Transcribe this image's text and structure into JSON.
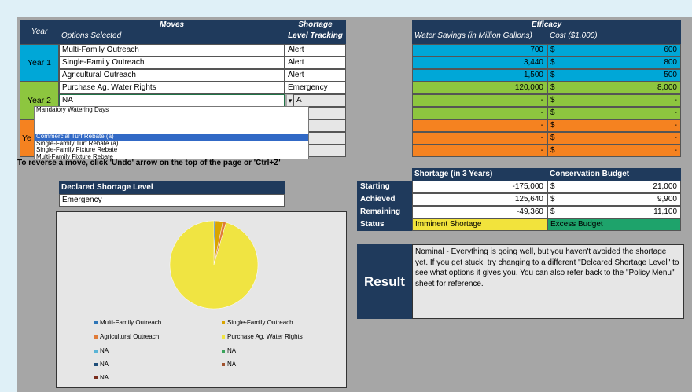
{
  "headers": {
    "year": "Year",
    "moves": "Moves",
    "options_selected": "Options Selected",
    "shortage": "Shortage",
    "level_tracking": "Level Tracking",
    "efficacy": "Efficacy",
    "water_savings": "Water Savings (in Million Gallons)",
    "cost": "Cost ($1,000)"
  },
  "years": {
    "year1": "Year 1",
    "year2": "Year 2",
    "year3_partial": "Ye"
  },
  "moves": [
    {
      "option": "Multi-Family Outreach",
      "level": "Alert",
      "savings": "700",
      "currency": "$",
      "cost": "600"
    },
    {
      "option": "Single-Family Outreach",
      "level": "Alert",
      "savings": "3,440",
      "currency": "$",
      "cost": "800"
    },
    {
      "option": "Agricultural Outreach",
      "level": "Alert",
      "savings": "1,500",
      "currency": "$",
      "cost": "500"
    },
    {
      "option": "Purchase Ag. Water Rights",
      "level": "Emergency",
      "savings": "120,000",
      "currency": "$",
      "cost": "8,000"
    },
    {
      "option": "NA",
      "level": "A",
      "savings": "-",
      "currency": "$",
      "cost": "-"
    },
    {
      "option": "",
      "level": "A",
      "savings": "-",
      "currency": "$",
      "cost": "-"
    },
    {
      "option": "",
      "level": "A",
      "savings": "-",
      "currency": "$",
      "cost": "-"
    },
    {
      "option": "",
      "level": "A",
      "savings": "-",
      "currency": "$",
      "cost": "-"
    },
    {
      "option": "",
      "level": "A",
      "savings": "-",
      "currency": "$",
      "cost": "-"
    }
  ],
  "dropdown": {
    "options": [
      "Mandatory Watering Days",
      "",
      "Commercial Turf Rebate (a)",
      "Single-Family Turf Rebate (a)",
      "Single-Family Fixture Rebate",
      "Multi-Family Fixture Rebate"
    ],
    "selected_index": 2,
    "arrow": "▾"
  },
  "undo_note": "To reverse a move, click 'Undo' arrow on the top of the page  or 'Ctrl+Z'",
  "declared": {
    "label": "Declared Shortage Level",
    "value": "Emergency"
  },
  "pie_chart": {
    "legend": [
      {
        "name": "Multi-Family Outreach",
        "color": "#2e75b6"
      },
      {
        "name": "Single-Family Outreach",
        "color": "#d9a400"
      },
      {
        "name": "Agricultural Outreach",
        "color": "#e07b39"
      },
      {
        "name": "Purchase Ag. Water Rights",
        "color": "#f0e442"
      },
      {
        "name": "NA",
        "color": "#5ab4d6"
      },
      {
        "name": "NA",
        "color": "#3aa35b"
      },
      {
        "name": "NA",
        "color": "#1f4e79"
      },
      {
        "name": "NA",
        "color": "#a0522d"
      },
      {
        "name": "NA",
        "color": "#7a2e1e"
      }
    ]
  },
  "chart_data": {
    "type": "pie",
    "categories": [
      "Multi-Family Outreach",
      "Single-Family Outreach",
      "Agricultural Outreach",
      "Purchase Ag. Water Rights",
      "NA",
      "NA",
      "NA",
      "NA",
      "NA"
    ],
    "values": [
      700,
      3440,
      1500,
      120000,
      0,
      0,
      0,
      0,
      0
    ],
    "colors": [
      "#2e75b6",
      "#d9a400",
      "#e07b39",
      "#f0e442",
      "#5ab4d6",
      "#3aa35b",
      "#1f4e79",
      "#a0522d",
      "#7a2e1e"
    ],
    "legend_position": "bottom"
  },
  "summary": {
    "shortage_header": "Shortage (in 3 Years)",
    "budget_header": "Conservation Budget",
    "rows": [
      {
        "label": "Starting",
        "shortage": "-175,000",
        "currency": "$",
        "budget": "21,000"
      },
      {
        "label": "Achieved",
        "shortage": "125,640",
        "currency": "$",
        "budget": "9,900"
      },
      {
        "label": "Remaining",
        "shortage": "-49,360",
        "currency": "$",
        "budget": "11,100"
      }
    ],
    "status_label": "Status",
    "status_shortage": "Imminent Shortage",
    "status_budget": "Excess Budget"
  },
  "result": {
    "label": "Result",
    "text": "Nominal - Everything is going well, but you haven't avoided the shortage yet. If you get stuck, try changing to a different \"Delcared Shortage Level\" to see what options it gives you. You can also refer back to the \"Policy Menu\" sheet for reference."
  },
  "colors": {
    "navy": "#1f3a5c",
    "year1": "#00a7d7",
    "year2": "#8dc63f",
    "year3": "#f58220",
    "status_yellow": "#f2e33c",
    "status_green": "#1ea36b"
  }
}
